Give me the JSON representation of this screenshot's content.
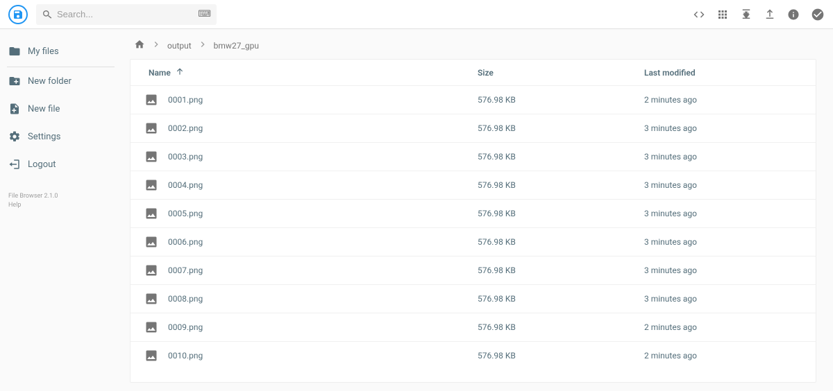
{
  "search": {
    "placeholder": "Search..."
  },
  "sidebar": {
    "items": [
      {
        "label": "My files"
      },
      {
        "label": "New folder"
      },
      {
        "label": "New file"
      },
      {
        "label": "Settings"
      },
      {
        "label": "Logout"
      }
    ],
    "footer_version": "File Browser 2.1.0",
    "footer_help": "Help"
  },
  "breadcrumb": {
    "items": [
      "output",
      "bmw27_gpu"
    ]
  },
  "columns": {
    "name": "Name",
    "size": "Size",
    "modified": "Last modified"
  },
  "files": [
    {
      "name": "0001.png",
      "size": "576.98 KB",
      "modified": "2 minutes ago"
    },
    {
      "name": "0002.png",
      "size": "576.98 KB",
      "modified": "3 minutes ago"
    },
    {
      "name": "0003.png",
      "size": "576.98 KB",
      "modified": "3 minutes ago"
    },
    {
      "name": "0004.png",
      "size": "576.98 KB",
      "modified": "3 minutes ago"
    },
    {
      "name": "0005.png",
      "size": "576.98 KB",
      "modified": "3 minutes ago"
    },
    {
      "name": "0006.png",
      "size": "576.98 KB",
      "modified": "3 minutes ago"
    },
    {
      "name": "0007.png",
      "size": "576.98 KB",
      "modified": "3 minutes ago"
    },
    {
      "name": "0008.png",
      "size": "576.98 KB",
      "modified": "3 minutes ago"
    },
    {
      "name": "0009.png",
      "size": "576.98 KB",
      "modified": "2 minutes ago"
    },
    {
      "name": "0010.png",
      "size": "576.98 KB",
      "modified": "2 minutes ago"
    }
  ]
}
